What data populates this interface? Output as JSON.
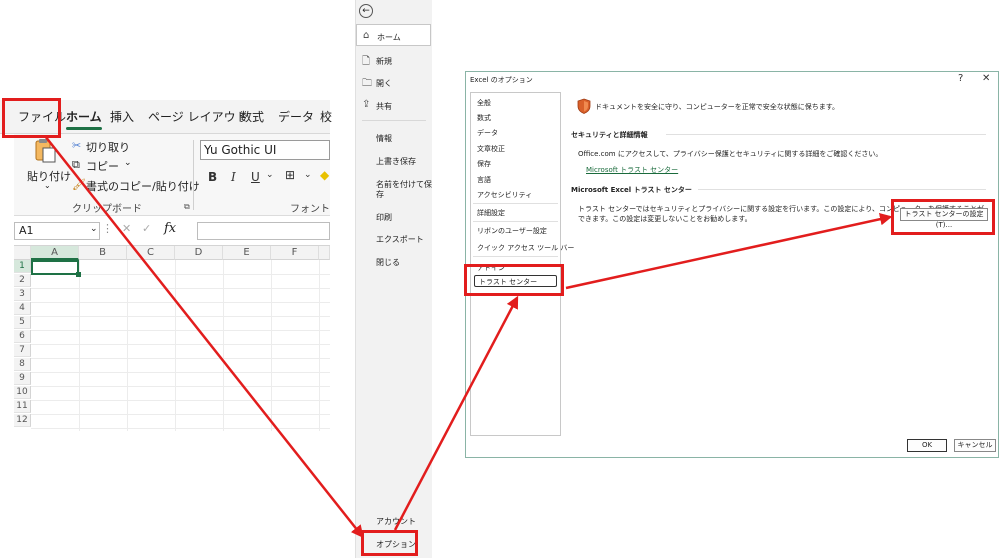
{
  "excel": {
    "tabs": [
      "ファイル",
      "ホーム",
      "挿入",
      "ページ レイアウト",
      "数式",
      "データ",
      "校"
    ],
    "clipboard": {
      "paste": "貼り付け",
      "cut": "切り取り",
      "copy": "コピー",
      "format_painter": "書式のコピー/貼り付け",
      "group": "クリップボード"
    },
    "font": {
      "name": "Yu Gothic UI",
      "group": "フォント",
      "bold": "B",
      "italic": "I",
      "underline": "U"
    },
    "namebox": "A1",
    "fx": "fx",
    "columns": [
      "A",
      "B",
      "C",
      "D",
      "E",
      "F"
    ],
    "rows": [
      "1",
      "2",
      "3",
      "4",
      "5",
      "6",
      "7",
      "8",
      "9",
      "10",
      "11",
      "12"
    ]
  },
  "backstage": {
    "items": [
      {
        "label": "ホーム"
      },
      {
        "label": "新規"
      },
      {
        "label": "開く"
      },
      {
        "label": "共有"
      },
      {
        "label": "情報"
      },
      {
        "label": "上書き保存"
      },
      {
        "label": "名前を付けて保"
      },
      {
        "label": "存"
      },
      {
        "label": "印刷"
      },
      {
        "label": "エクスポート"
      },
      {
        "label": "閉じる"
      },
      {
        "label": "アカウント"
      },
      {
        "label": "オプション"
      }
    ]
  },
  "dialog": {
    "title": "Excel のオプション",
    "help": "?",
    "close": "✕",
    "nav": [
      "全般",
      "数式",
      "データ",
      "文章校正",
      "保存",
      "言語",
      "アクセシビリティ",
      "詳細設定",
      "リボンのユーザー設定",
      "クイック アクセス ツール バー",
      "アドイン",
      "トラスト センター"
    ],
    "intro": "ドキュメントを安全に守り、コンピューターを正常で安全な状態に保ちます。",
    "section1_head": "セキュリティと詳細情報",
    "section1_text": "Office.com にアクセスして、プライバシー保護とセキュリティに関する詳細をご確認ください。",
    "section1_link": "Microsoft トラスト センター",
    "section2_head": "Microsoft Excel トラスト センター",
    "section2_line1": "トラスト センターではセキュリティとプライバシーに関する設定を行います。この設定により、コンピューターを保護することが",
    "section2_line2": "できます。この設定は変更しないことをお勧めします。",
    "tc_button": "トラスト センターの設定(T)...",
    "ok": "OK",
    "cancel": "キャンセル"
  },
  "colors": {
    "highlight": "#e21d1d",
    "excel_green": "#1e7145"
  }
}
